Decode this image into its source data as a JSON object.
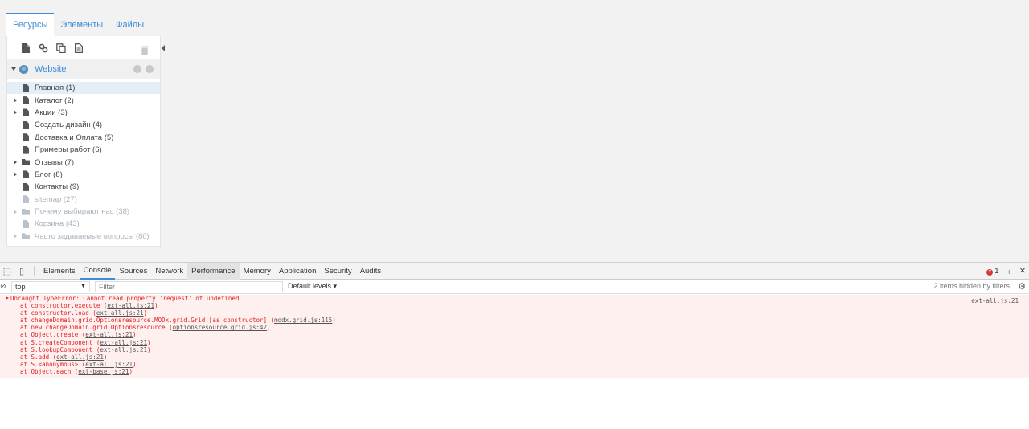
{
  "tabs": [
    {
      "label": "Ресурсы",
      "active": true
    },
    {
      "label": "Элементы",
      "active": false
    },
    {
      "label": "Файлы",
      "active": false
    }
  ],
  "site": {
    "label": "Website"
  },
  "tree": [
    {
      "label": "Главная (1)",
      "icon": "doc-icon",
      "expandable": false,
      "dim": false,
      "selected": true
    },
    {
      "label": "Каталог (2)",
      "icon": "cart-icon",
      "expandable": true,
      "dim": false,
      "selected": false
    },
    {
      "label": "Акции (3)",
      "icon": "percent-icon",
      "expandable": true,
      "dim": false,
      "selected": false
    },
    {
      "label": "Создать дизайн (4)",
      "icon": "doc-icon",
      "expandable": false,
      "dim": false,
      "selected": false
    },
    {
      "label": "Доставка и Оплата (5)",
      "icon": "car-icon",
      "expandable": false,
      "dim": false,
      "selected": false
    },
    {
      "label": "Примеры работ (6)",
      "icon": "briefcase-icon",
      "expandable": false,
      "dim": false,
      "selected": false
    },
    {
      "label": "Отзывы (7)",
      "icon": "folder-icon",
      "expandable": true,
      "dim": false,
      "selected": false
    },
    {
      "label": "Блог (8)",
      "icon": "pencil-icon",
      "expandable": true,
      "dim": false,
      "selected": false
    },
    {
      "label": "Контакты (9)",
      "icon": "envelope-icon",
      "expandable": false,
      "dim": false,
      "selected": false
    },
    {
      "label": "sitemap (27)",
      "icon": "doc-icon",
      "expandable": false,
      "dim": true,
      "selected": false
    },
    {
      "label": "Почему выбирают нас (38)",
      "icon": "folder-icon",
      "expandable": true,
      "dim": true,
      "selected": false
    },
    {
      "label": "Корзина (43)",
      "icon": "doc-icon",
      "expandable": false,
      "dim": true,
      "selected": false
    },
    {
      "label": "Часто задаваемые вопросы (80)",
      "icon": "folder-icon",
      "expandable": true,
      "dim": true,
      "selected": false
    }
  ],
  "devtools": {
    "tabs": [
      {
        "label": "Elements",
        "state": ""
      },
      {
        "label": "Console",
        "state": "active"
      },
      {
        "label": "Sources",
        "state": ""
      },
      {
        "label": "Network",
        "state": ""
      },
      {
        "label": "Performance",
        "state": "hover"
      },
      {
        "label": "Memory",
        "state": ""
      },
      {
        "label": "Application",
        "state": ""
      },
      {
        "label": "Security",
        "state": ""
      },
      {
        "label": "Audits",
        "state": ""
      }
    ],
    "error_count": "1",
    "context": "top",
    "filter_placeholder": "Filter",
    "levels": "Default levels ▾",
    "hidden_info": "2 items hidden by filters",
    "error": {
      "message": "Uncaught TypeError: Cannot read property 'request' of undefined",
      "source": "ext-all.js:21",
      "stack": [
        {
          "text": "at constructor.execute (",
          "link": "ext-all.js:21"
        },
        {
          "text": "at constructor.load (",
          "link": "ext-all.js:21"
        },
        {
          "text": "at changeDomain.grid.Optionsresource.MODx.grid.Grid [as constructor] (",
          "link": "modx.grid.js:115"
        },
        {
          "text": "at new changeDomain.grid.Optionsresource (",
          "link": "optionsresource.grid.js:42"
        },
        {
          "text": "at Object.create (",
          "link": "ext-all.js:21"
        },
        {
          "text": "at S.createComponent (",
          "link": "ext-all.js:21"
        },
        {
          "text": "at S.lookupComponent (",
          "link": "ext-all.js:21"
        },
        {
          "text": "at S.add (",
          "link": "ext-all.js:21"
        },
        {
          "text": "at S.<anonymous> (",
          "link": "ext-all.js:21"
        },
        {
          "text": "at Object.each (",
          "link": "ext-base.js:21"
        }
      ]
    }
  },
  "colors": {
    "accent": "#3c8dd9",
    "error": "#e02020",
    "error_bg": "#fff0f0"
  }
}
